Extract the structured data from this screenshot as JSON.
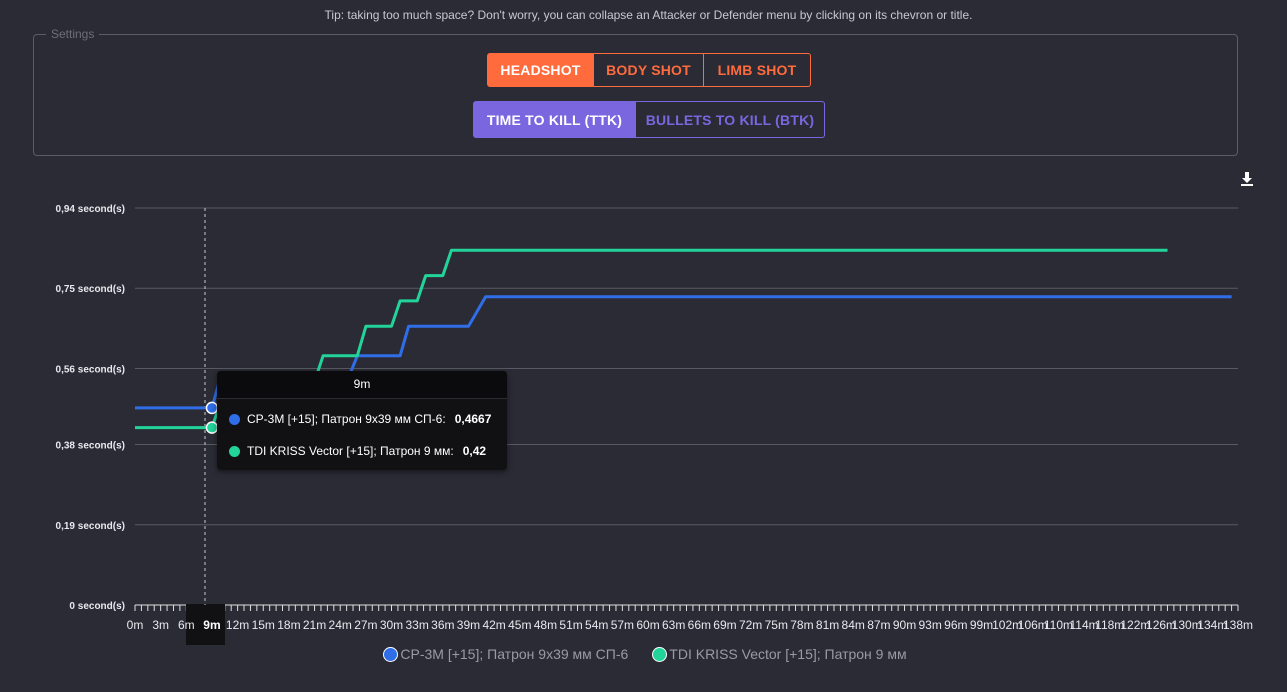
{
  "tip": "Tip: taking too much space? Don't worry, you can collapse an Attacker or Defender menu by clicking on its chevron or title.",
  "settings": {
    "legend": "Settings",
    "shot_buttons": [
      {
        "label": "HEADSHOT",
        "active": true
      },
      {
        "label": "BODY SHOT",
        "active": false
      },
      {
        "label": "LIMB SHOT",
        "active": false
      }
    ],
    "metric_buttons": [
      {
        "label": "TIME TO KILL (TTK)",
        "active": true
      },
      {
        "label": "BULLETS TO KILL (BTK)",
        "active": false
      }
    ]
  },
  "colors": {
    "accent_orange": "#ff6b3d",
    "accent_purple": "#7a67e0",
    "series_blue": "#2f6ee8",
    "series_green": "#22d49a"
  },
  "download_icon": "download-icon",
  "tooltip": {
    "title": "9m",
    "rows": [
      {
        "label": "СР-3М [+15]; Патрон 9x39 мм СП-6:",
        "value": "0,4667",
        "color": "#2f6ee8"
      },
      {
        "label": "TDI KRISS Vector [+15]; Патрон 9 мм:",
        "value": "0,42",
        "color": "#22d49a"
      }
    ]
  },
  "chart_data": {
    "type": "line",
    "y_ticks": [
      {
        "value": 0,
        "label": "0 second(s)"
      },
      {
        "value": 0.19,
        "label": "0,19 second(s)"
      },
      {
        "value": 0.38,
        "label": "0,38 second(s)"
      },
      {
        "value": 0.56,
        "label": "0,56 second(s)"
      },
      {
        "value": 0.75,
        "label": "0,75 second(s)"
      },
      {
        "value": 0.94,
        "label": "0,94 second(s)"
      }
    ],
    "ylim": [
      0,
      0.94
    ],
    "x_labels": [
      "0m",
      "3m",
      "6m",
      "9m",
      "12m",
      "15m",
      "18m",
      "21m",
      "24m",
      "27m",
      "30m",
      "33m",
      "36m",
      "39m",
      "42m",
      "45m",
      "48m",
      "51m",
      "54m",
      "57m",
      "60m",
      "63m",
      "66m",
      "69m",
      "72m",
      "75m",
      "78m",
      "81m",
      "84m",
      "87m",
      "90m",
      "93m",
      "96m",
      "99m",
      "102m",
      "106m",
      "110m",
      "114m",
      "118m",
      "122m",
      "126m",
      "130m",
      "134m",
      "138m"
    ],
    "xlim": [
      0,
      138
    ],
    "highlight_x": "9m",
    "series": [
      {
        "name": "СР-3М [+15]; Патрон 9x39 мм СП-6",
        "color": "#2f6ee8",
        "x": [
          0,
          9,
          10,
          25,
          26,
          31,
          32,
          37,
          38,
          39,
          41,
          137
        ],
        "y": [
          0.4667,
          0.4667,
          0.54,
          0.54,
          0.59,
          0.59,
          0.66,
          0.66,
          0.66,
          0.66,
          0.73,
          0.73
        ]
      },
      {
        "name": "TDI KRISS Vector [+15]; Патрон 9 мм",
        "color": "#22d49a",
        "x": [
          0,
          9,
          10,
          17,
          18,
          21,
          22,
          26,
          27,
          30,
          31,
          33,
          34,
          36,
          37,
          127
        ],
        "y": [
          0.42,
          0.42,
          0.48,
          0.48,
          0.53,
          0.53,
          0.59,
          0.59,
          0.66,
          0.66,
          0.72,
          0.72,
          0.78,
          0.78,
          0.84,
          0.84
        ]
      }
    ]
  }
}
